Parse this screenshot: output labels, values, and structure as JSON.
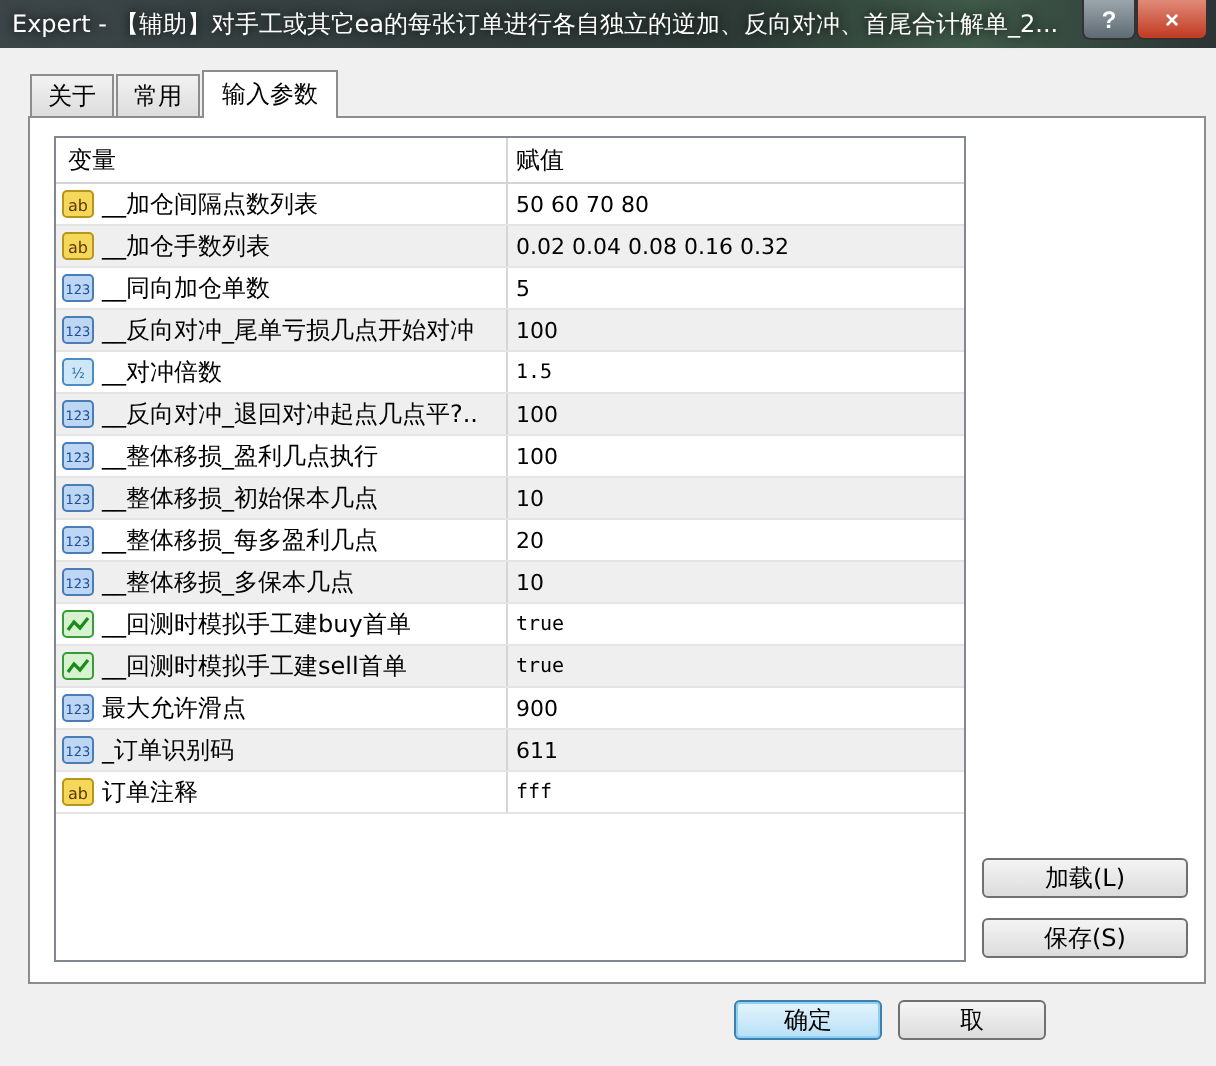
{
  "window": {
    "title": "Expert - 【辅助】对手工或其它ea的每张订单进行各自独立的逆加、反向对冲、首尾合计解单_2..."
  },
  "title_buttons": {
    "help": "?",
    "close": "×"
  },
  "tabs": [
    {
      "label": "关于",
      "selected": false
    },
    {
      "label": "常用",
      "selected": false
    },
    {
      "label": "输入参数",
      "selected": true
    }
  ],
  "table": {
    "columns": [
      "变量",
      "赋值"
    ],
    "rows": [
      {
        "kind": "string",
        "icon_text": "ab",
        "name": "__加仓间隔点数列表",
        "value": "50 60 70 80"
      },
      {
        "kind": "string",
        "icon_text": "ab",
        "name": "__加仓手数列表",
        "value": "0.02 0.04 0.08 0.16 0.32"
      },
      {
        "kind": "int",
        "icon_text": "123",
        "name": "__同向加仓单数",
        "value": "5"
      },
      {
        "kind": "int",
        "icon_text": "123",
        "name": "__反向对冲_尾单亏损几点开始对冲",
        "value": "100"
      },
      {
        "kind": "double",
        "icon_text": "½",
        "name": "__对冲倍数",
        "value": "1.5"
      },
      {
        "kind": "int",
        "icon_text": "123",
        "name": "__反向对冲_退回对冲起点几点平?..",
        "value": "100"
      },
      {
        "kind": "int",
        "icon_text": "123",
        "name": "__整体移损_盈利几点执行",
        "value": "100"
      },
      {
        "kind": "int",
        "icon_text": "123",
        "name": "__整体移损_初始保本几点",
        "value": "10"
      },
      {
        "kind": "int",
        "icon_text": "123",
        "name": "__整体移损_每多盈利几点",
        "value": "20"
      },
      {
        "kind": "int",
        "icon_text": "123",
        "name": "__整体移损_多保本几点",
        "value": "10"
      },
      {
        "kind": "bool",
        "name": "__回测时模拟手工建buy首单",
        "value": "true"
      },
      {
        "kind": "bool",
        "name": "__回测时模拟手工建sell首单",
        "value": "true"
      },
      {
        "kind": "int",
        "icon_text": "123",
        "name": "最大允许滑点",
        "value": "900"
      },
      {
        "kind": "int",
        "icon_text": "123",
        "name": "_订单识别码",
        "value": "611"
      },
      {
        "kind": "string",
        "icon_text": "ab",
        "name": "订单注释",
        "value": "fff"
      }
    ]
  },
  "side_buttons": [
    "加载(L)",
    "保存(S)"
  ],
  "footer_buttons": [
    {
      "label": "确定",
      "selected": true
    },
    {
      "label": "取",
      "selected": false
    }
  ]
}
